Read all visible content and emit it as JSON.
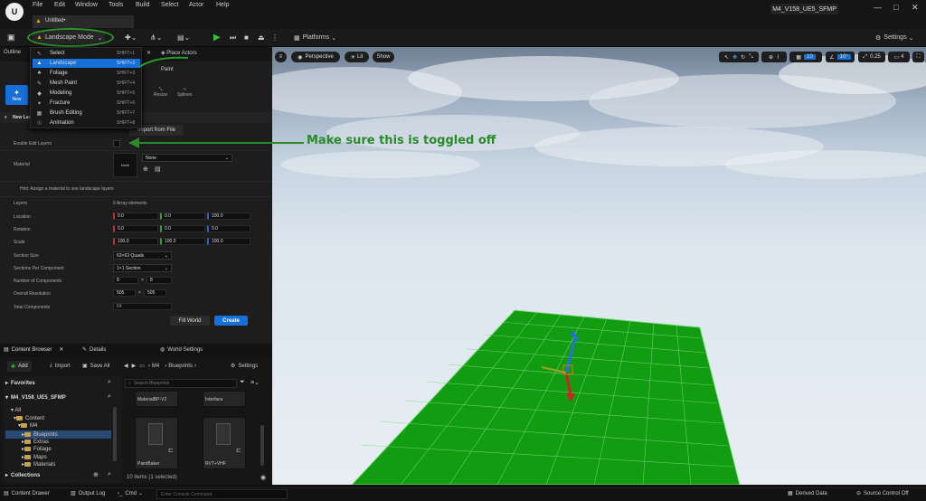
{
  "menubar": {
    "items": [
      "File",
      "Edit",
      "Window",
      "Tools",
      "Build",
      "Select",
      "Actor",
      "Help"
    ],
    "project": "M4_V158_UE5_SFMP",
    "level_tab": "Untitled•"
  },
  "toolbar": {
    "mode_button": "Landscape Mode",
    "platforms": "Platforms",
    "settings": "Settings"
  },
  "mode_menu": {
    "items": [
      {
        "label": "Select",
        "shortcut": "SHIFT+1",
        "icon": "cursor-icon"
      },
      {
        "label": "Landscape",
        "shortcut": "SHIFT+2",
        "icon": "landscape-icon"
      },
      {
        "label": "Foliage",
        "shortcut": "SHIFT+3",
        "icon": "foliage-icon"
      },
      {
        "label": "Mesh Paint",
        "shortcut": "SHIFT+4",
        "icon": "paintbrush-icon"
      },
      {
        "label": "Modeling",
        "shortcut": "SHIFT+5",
        "icon": "modeling-icon"
      },
      {
        "label": "Fracture",
        "shortcut": "SHIFT+6",
        "icon": "fracture-icon"
      },
      {
        "label": "Brush Editing",
        "shortcut": "SHIFT+7",
        "icon": "brush-icon"
      },
      {
        "label": "Animation",
        "shortcut": "SHIFT+8",
        "icon": "animation-icon"
      }
    ]
  },
  "left_tabs": {
    "outliner": "Outline",
    "place_actors": "Place Actors"
  },
  "landscape_tools": {
    "new": "New",
    "paint": "Paint",
    "resize": "Resize",
    "splines": "Splines",
    "new_landscape": "New Lan",
    "import_from_file": "Import from File"
  },
  "properties": {
    "enable_edit_layers": "Enable Edit Layers",
    "material_label": "Material",
    "material_thumb": "None",
    "material_value": "None",
    "hint": "Hint: Assign a material to see landscape layers",
    "layers_label": "Layers",
    "layers_value": "0 Array elements",
    "location_label": "Location",
    "location": [
      "0.0",
      "0.0",
      "100.0"
    ],
    "rotation_label": "Rotation",
    "rotation": [
      "0.0",
      "0.0",
      "0.0"
    ],
    "scale_label": "Scale",
    "scale": [
      "100.0",
      "100.0",
      "100.0"
    ],
    "section_size_label": "Section Size",
    "section_size": "63×63 Quads",
    "sections_per_component_label": "Sections Per Component",
    "sections_per_component": "1×1 Section",
    "number_of_components_label": "Number of Components",
    "components": [
      "8",
      "8"
    ],
    "overall_resolution_label": "Overall Resolution",
    "resolution": [
      "505",
      "505"
    ],
    "total_components_label": "Total Components",
    "total_components": "64",
    "fill_world": "Fill World",
    "create": "Create"
  },
  "annotation": {
    "text": "Make sure this is toggled off",
    "color": "#2a8a2a"
  },
  "viewport": {
    "perspective": "Perspective",
    "lit": "Lit",
    "show": "Show",
    "grid": "10",
    "angle": "10°",
    "scale": "0.25",
    "cameras": "4"
  },
  "bottom_tabs": {
    "content_browser": "Content Browser",
    "details": "Details",
    "world_settings": "World Settings"
  },
  "content_browser": {
    "add": "Add",
    "import": "Import",
    "save_all": "Save All",
    "path": [
      "M4",
      "Blueprints"
    ],
    "settings": "Settings",
    "favorites": "Favorites",
    "project_root": "M4_V158_UE5_SFMP",
    "tree": [
      "All",
      "Content",
      "M4",
      "Blueprints",
      "Extras",
      "Foliage",
      "Maps",
      "Materials"
    ],
    "collections": "Collections",
    "search_placeholder": "Search Blueprints",
    "assets": [
      "MaterialBP-V2",
      "Interface",
      "PaintBaker",
      "RVT+VHF"
    ],
    "count": "10 items (1 selected)"
  },
  "statusbar": {
    "content_drawer": "Content Drawer",
    "output_log": "Output Log",
    "cmd": "Cmd",
    "console_placeholder": "Enter Console Command",
    "derived_data": "Derived Data",
    "source_control": "Source Control Off"
  },
  "colors": {
    "accent": "#1670d8",
    "landscape_green": "#119c11",
    "grid_line": "#7fd87f",
    "annotation": "#2a8a2a"
  }
}
